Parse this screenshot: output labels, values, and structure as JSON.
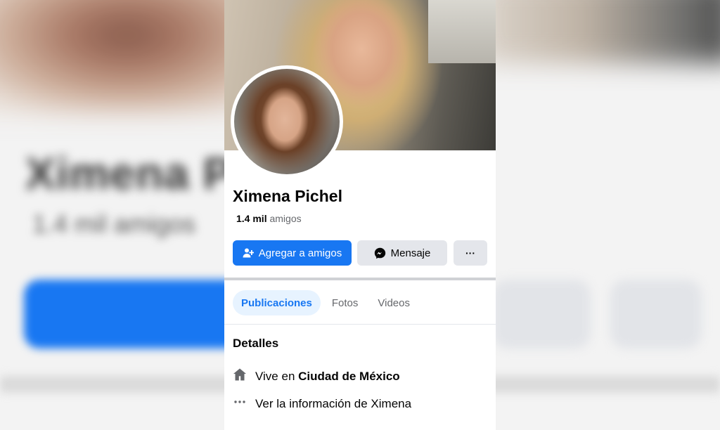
{
  "profile": {
    "name": "Ximena Pichel",
    "friends_count": "1.4 mil",
    "friends_label": "amigos"
  },
  "actions": {
    "add_friend": "Agregar a amigos",
    "message": "Mensaje",
    "more": "···"
  },
  "tabs": [
    {
      "label": "Publicaciones",
      "active": true
    },
    {
      "label": "Fotos",
      "active": false
    },
    {
      "label": "Videos",
      "active": false
    }
  ],
  "details": {
    "title": "Detalles",
    "lives_prefix": "Vive en",
    "lives_city": "Ciudad de México",
    "see_info": "Ver la información de Ximena"
  },
  "colors": {
    "primary": "#1877f2",
    "button_gray": "#e4e6eb",
    "active_tab_bg": "#e7f3ff",
    "text_secondary": "#65676b"
  },
  "icons": {
    "add_friend": "add-person-icon",
    "message": "messenger-icon",
    "home": "home-icon",
    "more": "more-dots-icon"
  }
}
